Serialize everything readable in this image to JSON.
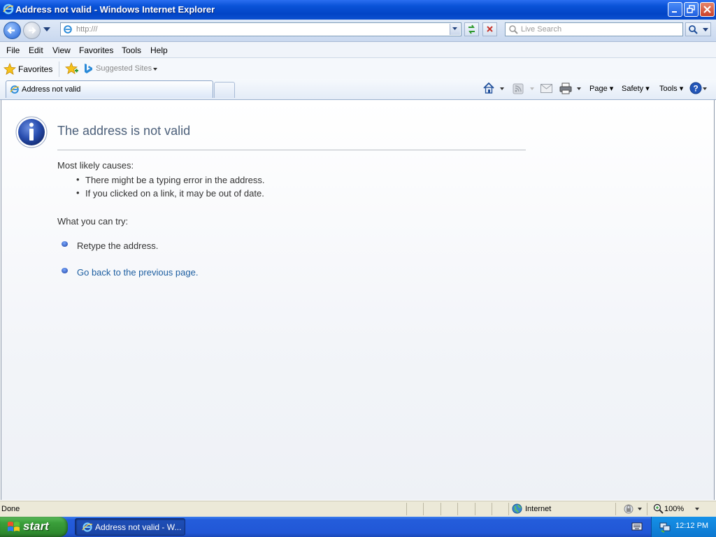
{
  "window": {
    "title": "Address not valid - Windows Internet Explorer"
  },
  "nav": {
    "address": "http:///",
    "search_placeholder": "Live Search"
  },
  "menu": {
    "items": [
      "File",
      "Edit",
      "View",
      "Favorites",
      "Tools",
      "Help"
    ]
  },
  "favorites_bar": {
    "favorites_label": "Favorites",
    "suggested_sites_label": "Suggested Sites"
  },
  "tabs": {
    "active_label": "Address not valid"
  },
  "command_bar": {
    "page_label": "Page",
    "safety_label": "Safety",
    "tools_label": "Tools"
  },
  "page": {
    "title": "The address is not valid",
    "causes_heading": "Most likely causes:",
    "causes": [
      "There might be a typing error in the address.",
      "If you clicked on a link, it may be out of date."
    ],
    "try_heading": "What you can try:",
    "retype": "Retype the address.",
    "go_back": "Go back to the previous page."
  },
  "status": {
    "text": "Done",
    "zone": "Internet",
    "zoom": "100%"
  },
  "taskbar": {
    "start_label": "start",
    "task_label": "Address not valid - W...",
    "clock": "12:12 PM"
  },
  "colors": {
    "title_bar": "#0a53d8",
    "link": "#1c5ea0",
    "heading": "#4c607a",
    "taskbar": "#245ddb",
    "start_button": "#3a9e3a"
  }
}
